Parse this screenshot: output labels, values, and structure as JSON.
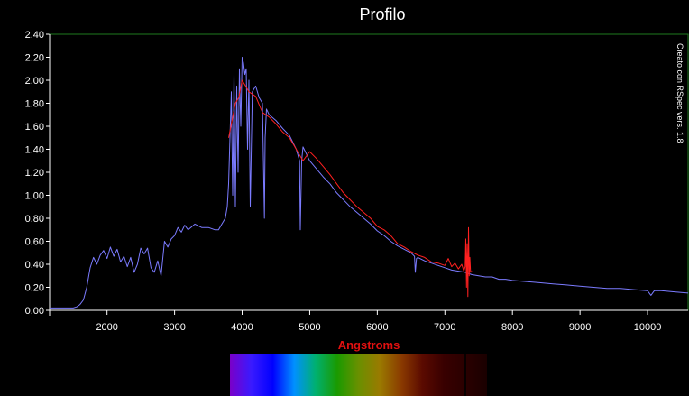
{
  "chart_data": {
    "type": "line",
    "title": "Profilo",
    "xlabel": "Angstroms",
    "ylabel": "",
    "xlim": [
      1150,
      10600
    ],
    "ylim": [
      0.0,
      2.4
    ],
    "x_ticks": [
      2000,
      3000,
      4000,
      5000,
      6000,
      7000,
      8000,
      9000,
      10000
    ],
    "y_ticks": [
      "0.00",
      "0.20",
      "0.40",
      "0.60",
      "0.80",
      "1.00",
      "1.20",
      "1.40",
      "1.60",
      "1.80",
      "2.00",
      "2.20",
      "2.40"
    ],
    "side_note": "Creato con RSpec vers. 1.8",
    "grid": false,
    "series": [
      {
        "color": "#7b7bff",
        "x": [
          1150,
          1300,
          1400,
          1500,
          1550,
          1600,
          1650,
          1700,
          1750,
          1800,
          1850,
          1900,
          1950,
          2000,
          2050,
          2100,
          2150,
          2200,
          2250,
          2300,
          2350,
          2400,
          2450,
          2500,
          2550,
          2600,
          2650,
          2700,
          2750,
          2800,
          2850,
          2900,
          2950,
          3000,
          3050,
          3100,
          3150,
          3200,
          3300,
          3400,
          3500,
          3600,
          3650,
          3700,
          3750,
          3780,
          3800,
          3820,
          3840,
          3860,
          3880,
          3900,
          3920,
          3940,
          3960,
          3980,
          4000,
          4020,
          4040,
          4060,
          4080,
          4100,
          4120,
          4150,
          4200,
          4250,
          4300,
          4330,
          4340,
          4360,
          4400,
          4500,
          4600,
          4700,
          4800,
          4850,
          4861,
          4880,
          4900,
          5000,
          5100,
          5200,
          5300,
          5400,
          5500,
          5600,
          5700,
          5800,
          5900,
          6000,
          6100,
          6200,
          6300,
          6400,
          6500,
          6550,
          6563,
          6580,
          6600,
          6700,
          6800,
          6900,
          7000,
          7100,
          7200,
          7300,
          7400,
          7500,
          7600,
          7700,
          7800,
          7900,
          8000,
          8200,
          8400,
          8600,
          8800,
          9000,
          9200,
          9400,
          9600,
          9800,
          10000,
          10050,
          10100,
          10200,
          10400,
          10600
        ],
        "y": [
          0.02,
          0.02,
          0.02,
          0.02,
          0.03,
          0.05,
          0.09,
          0.2,
          0.37,
          0.46,
          0.4,
          0.48,
          0.52,
          0.45,
          0.55,
          0.47,
          0.53,
          0.42,
          0.47,
          0.38,
          0.46,
          0.33,
          0.4,
          0.54,
          0.49,
          0.54,
          0.37,
          0.33,
          0.43,
          0.3,
          0.6,
          0.55,
          0.62,
          0.65,
          0.72,
          0.68,
          0.74,
          0.7,
          0.75,
          0.72,
          0.72,
          0.7,
          0.7,
          0.75,
          0.8,
          0.9,
          1.1,
          1.5,
          1.9,
          1.0,
          2.05,
          0.9,
          1.95,
          1.2,
          2.1,
          1.6,
          2.2,
          2.15,
          2.05,
          2.1,
          1.4,
          2.0,
          0.9,
          1.9,
          1.95,
          1.85,
          1.8,
          0.8,
          1.5,
          1.75,
          1.7,
          1.65,
          1.58,
          1.52,
          1.4,
          1.3,
          0.7,
          1.3,
          1.42,
          1.3,
          1.23,
          1.16,
          1.1,
          1.02,
          0.96,
          0.9,
          0.85,
          0.8,
          0.75,
          0.69,
          0.65,
          0.6,
          0.56,
          0.53,
          0.5,
          0.47,
          0.33,
          0.45,
          0.46,
          0.43,
          0.41,
          0.39,
          0.37,
          0.35,
          0.34,
          0.33,
          0.31,
          0.3,
          0.29,
          0.29,
          0.27,
          0.27,
          0.26,
          0.25,
          0.24,
          0.23,
          0.22,
          0.21,
          0.2,
          0.19,
          0.19,
          0.18,
          0.17,
          0.13,
          0.17,
          0.17,
          0.16,
          0.15
        ]
      },
      {
        "color": "#ff2020",
        "x": [
          3800,
          3850,
          3900,
          3950,
          4000,
          4050,
          4100,
          4200,
          4300,
          4400,
          4500,
          4600,
          4700,
          4800,
          4900,
          5000,
          5100,
          5200,
          5300,
          5400,
          5500,
          5600,
          5700,
          5800,
          5900,
          6000,
          6100,
          6200,
          6300,
          6400,
          6500,
          6600,
          6700,
          6800,
          6900,
          7000,
          7050,
          7100,
          7150,
          7200,
          7250,
          7280,
          7300,
          7310,
          7320,
          7330,
          7340,
          7350,
          7360,
          7370,
          7380,
          7400
        ],
        "y": [
          1.5,
          1.65,
          1.8,
          1.85,
          2.0,
          1.95,
          1.9,
          1.86,
          1.72,
          1.68,
          1.62,
          1.55,
          1.5,
          1.4,
          1.3,
          1.38,
          1.32,
          1.25,
          1.18,
          1.1,
          1.02,
          0.96,
          0.9,
          0.85,
          0.8,
          0.73,
          0.7,
          0.65,
          0.58,
          0.55,
          0.51,
          0.48,
          0.46,
          0.42,
          0.41,
          0.39,
          0.45,
          0.38,
          0.41,
          0.36,
          0.4,
          0.34,
          0.38,
          0.62,
          0.2,
          0.58,
          0.12,
          0.72,
          0.3,
          0.46,
          0.33,
          0.34
        ]
      }
    ],
    "spectrum_strip": [
      {
        "color": "#7a00c8"
      },
      {
        "color": "#3a1aff"
      },
      {
        "color": "#0000ff"
      },
      {
        "color": "#0090ff"
      },
      {
        "color": "#00b070"
      },
      {
        "color": "#1a9a00"
      },
      {
        "color": "#6a9000"
      },
      {
        "color": "#9a7a00"
      },
      {
        "color": "#8a3a00"
      },
      {
        "color": "#5a0a00"
      },
      {
        "color": "#380000"
      },
      {
        "color": "#2a0000"
      },
      {
        "color": "#1a0000"
      }
    ]
  }
}
